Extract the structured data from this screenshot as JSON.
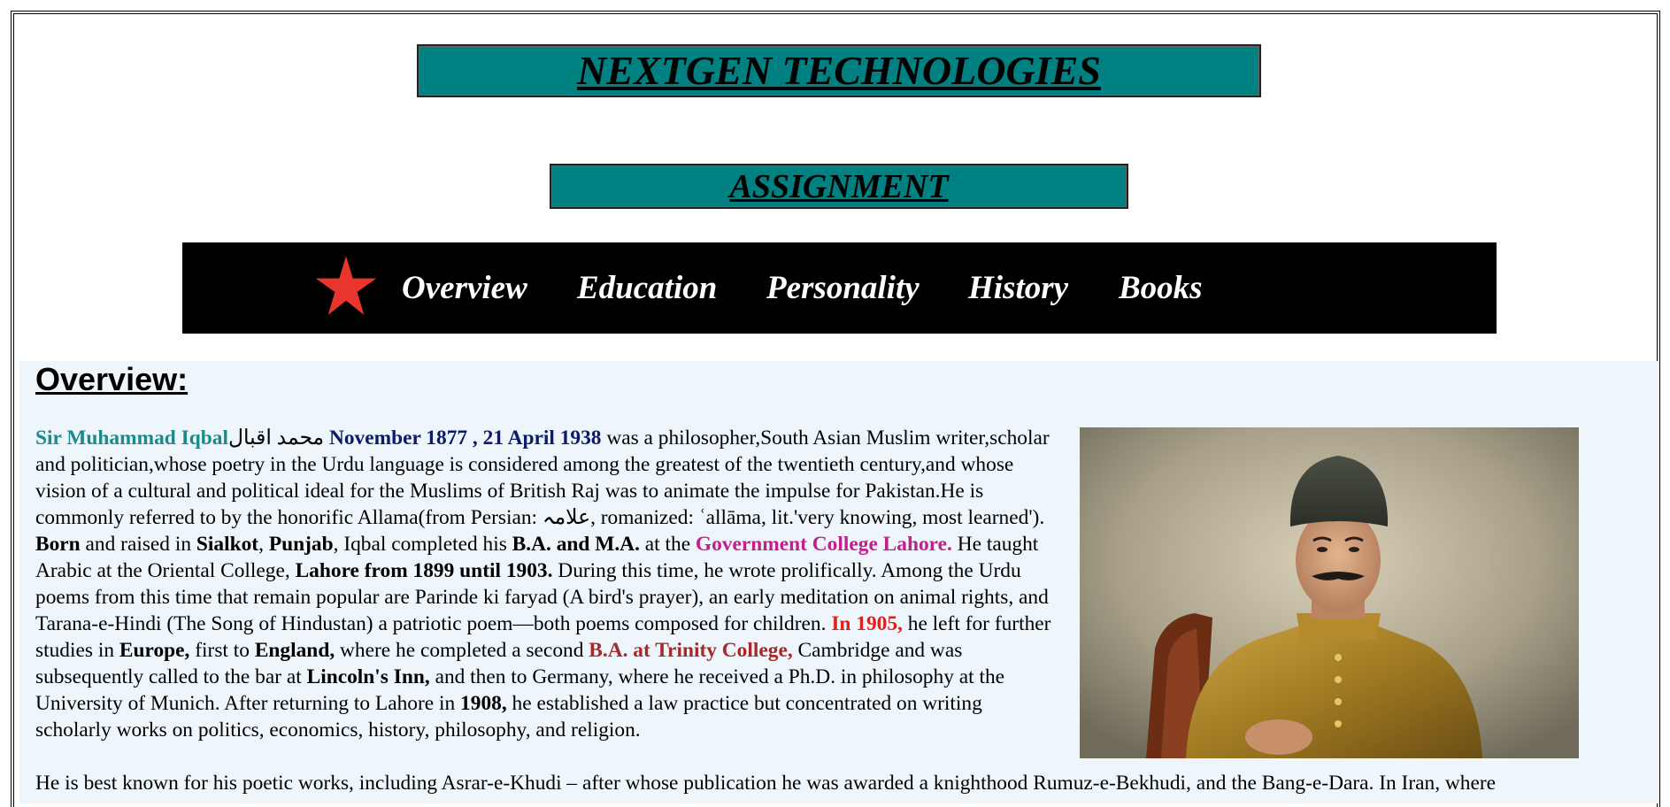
{
  "header": {
    "company": "NEXTGEN TECHNOLOGIES",
    "assignment": "ASSIGNMENT"
  },
  "nav": {
    "items": [
      {
        "label": "Overview"
      },
      {
        "label": "Education"
      },
      {
        "label": "Personality"
      },
      {
        "label": "History"
      },
      {
        "label": "Books"
      }
    ],
    "star_icon": "star-icon",
    "star_color": "#e8352e"
  },
  "overview": {
    "heading": "Overview:",
    "name": "Sir Muhammad Iqbal",
    "urdu_name": "محمد اقبال",
    "dates": "November 1877 , 21 April 1938",
    "t1": " was a philosopher,South Asian Muslim writer,scholar and politician,whose poetry in the Urdu language is considered among the greatest of the twentieth century,and whose vision of a cultural and political ideal for the Muslims of British Raj was to animate the impulse for Pakistan.He is commonly referred to by the honorific Allama(from Persian: علامہ, romanized: ʿallāma, lit.'very knowing, most learned'). ",
    "born": "Born",
    "t2": " and raised in ",
    "sialkot": "Sialkot",
    "t3": ", ",
    "punjab": "Punjab",
    "t4": ", Iqbal completed his ",
    "ba_ma": "B.A. and M.A.",
    "t5": " at the ",
    "gcl": "Government College Lahore.",
    "t6": " He taught Arabic at the Oriental College, ",
    "lahore_years": "Lahore from 1899 until 1903.",
    "t7": " During this time, he wrote prolifically. Among the Urdu poems from this time that remain popular are Parinde ki faryad (A bird's prayer), an early meditation on animal rights, and Tarana-e-Hindi (The Song of Hindustan) a patriotic poem—both poems composed for children. ",
    "in1905": "In 1905,",
    "t8": " he left for further studies in ",
    "europe": "Europe,",
    "t9": " first to ",
    "england": "England,",
    "t10": " where he completed a second ",
    "trinity": "B.A. at Trinity College,",
    "t11": " Cambridge and was subsequently called to the bar at ",
    "lincolns": "Lincoln's Inn,",
    "t12": " and then to Germany, where he received a Ph.D. in philosophy at the University of Munich. After returning to Lahore in ",
    "y1908": "1908,",
    "t13": " he established a law practice but concentrated on writing scholarly works on politics, economics, history, philosophy, and religion.",
    "next_line": "He is best known for his poetic works, including Asrar-e-Khudi – after whose publication he was awarded a knighthood Rumuz-e-Bekhudi, and the Bang-e-Dara. In Iran, where"
  }
}
